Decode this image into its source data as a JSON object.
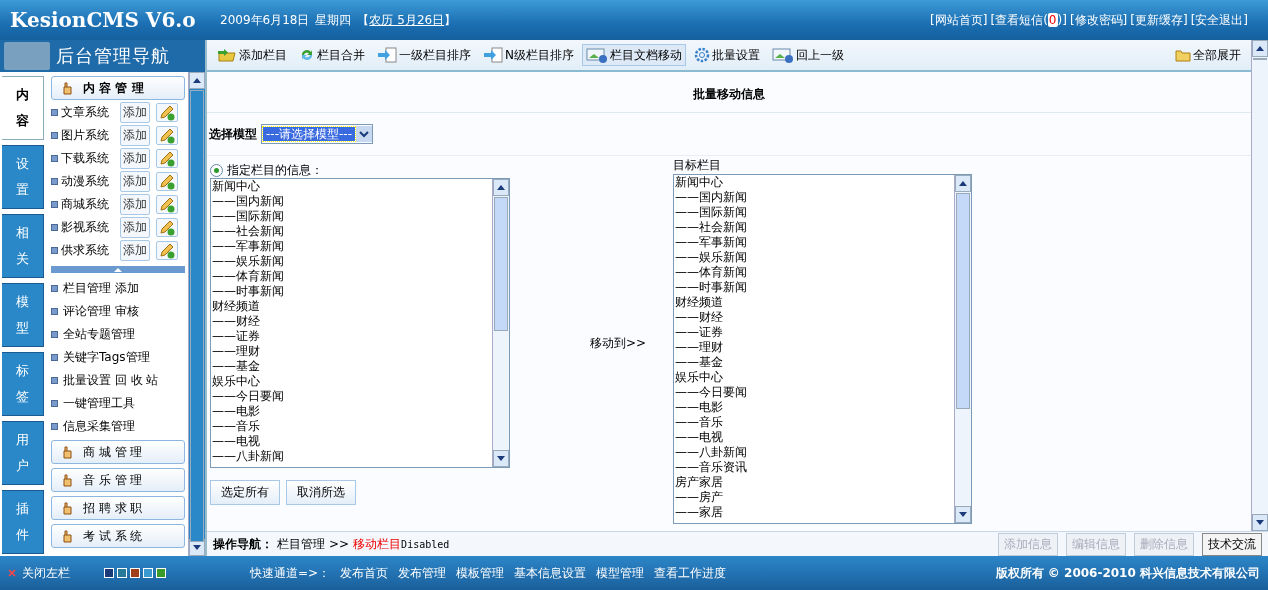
{
  "header": {
    "logo": "KesionCMS V6.o",
    "date": "2009年6月18日",
    "weekday": "星期四",
    "lunar_open": "【",
    "lunar": "农历 5月26日",
    "lunar_close": "】",
    "links": [
      {
        "text": "[网站首页]"
      },
      {
        "text": "[查看短信(",
        "count": "0",
        "after": ")]"
      },
      {
        "text": "[修改密码]"
      },
      {
        "text": "[更新缓存]"
      },
      {
        "text": "[安全退出]"
      }
    ]
  },
  "sidebar": {
    "banner_title": "后台管理导航",
    "tabs": [
      {
        "label": "内容",
        "selected": true
      },
      {
        "label": "设置",
        "selected": false
      },
      {
        "label": "相关",
        "selected": false
      },
      {
        "label": "模型",
        "selected": false
      },
      {
        "label": "标签",
        "selected": false
      },
      {
        "label": "用户",
        "selected": false
      },
      {
        "label": "插件",
        "selected": false
      }
    ],
    "content_group": {
      "title": "内 容 管 理",
      "systems": [
        {
          "name": "文章系统",
          "add": "添加"
        },
        {
          "name": "图片系统",
          "add": "添加"
        },
        {
          "name": "下载系统",
          "add": "添加"
        },
        {
          "name": "动漫系统",
          "add": "添加"
        },
        {
          "name": "商城系统",
          "add": "添加"
        },
        {
          "name": "影视系统",
          "add": "添加"
        },
        {
          "name": "供求系统",
          "add": "添加"
        }
      ],
      "links": [
        "栏目管理 添加",
        "评论管理 审核",
        "全站专题管理",
        "关键字Tags管理",
        "批量设置 回 收 站",
        "一键管理工具",
        "信息采集管理"
      ]
    },
    "other_groups": [
      "商 城 管 理",
      "音 乐 管 理",
      "招 聘 求 职",
      "考 试 系 统"
    ]
  },
  "toolbar": {
    "items": [
      {
        "label": "添加栏目",
        "kind": "add",
        "selected": false
      },
      {
        "label": "栏目合并",
        "kind": "merge",
        "selected": false
      },
      {
        "label": "一级栏目排序",
        "kind": "sort",
        "selected": false
      },
      {
        "label": "N级栏目排序",
        "kind": "sort",
        "selected": false
      },
      {
        "label": "栏目文档移动",
        "kind": "move",
        "selected": true
      },
      {
        "label": "批量设置",
        "kind": "gear",
        "selected": false
      },
      {
        "label": "回上一级",
        "kind": "move",
        "selected": false
      }
    ],
    "expand_all": "全部展开"
  },
  "panel": {
    "title": "批量移动信息",
    "model_label": "选择模型",
    "model_select": "---请选择模型---",
    "radio": {
      "label": "指定栏目的信息：",
      "checked": true
    },
    "source_list": [
      "新闻中心",
      "——国内新闻",
      "——国际新闻",
      "——社会新闻",
      "——军事新闻",
      "——娱乐新闻",
      "——体育新闻",
      "——时事新闻",
      "财经频道",
      "——财经",
      "——证券",
      "——理财",
      "——基金",
      "娱乐中心",
      "——今日要闻",
      "——电影",
      "——音乐",
      "——电视",
      "——八卦新闻"
    ],
    "select_buttons": [
      "选定所有",
      "取消所选"
    ],
    "move_label": "移动到>>",
    "target_label": "目标栏目",
    "target_list": [
      "新闻中心",
      "——国内新闻",
      "——国际新闻",
      "——社会新闻",
      "——军事新闻",
      "——娱乐新闻",
      "——体育新闻",
      "——时事新闻",
      "财经频道",
      "——财经",
      "——证券",
      "——理财",
      "——基金",
      "娱乐中心",
      "——今日要闻",
      "——电影",
      "——音乐",
      "——电视",
      "——八卦新闻",
      "——音乐资讯",
      "房产家居",
      "——房产",
      "——家居"
    ]
  },
  "breadcrumb": {
    "label": "操作导航：",
    "path": "栏目管理",
    "separator": ">>",
    "current": "移动栏目",
    "status": "Disabled"
  },
  "actions": [
    {
      "label": "添加信息",
      "disabled": true
    },
    {
      "label": "编辑信息",
      "disabled": true
    },
    {
      "label": "删除信息",
      "disabled": true
    },
    {
      "label": "技术交流",
      "disabled": false
    }
  ],
  "footer": {
    "close_left": "关闭左栏",
    "swatches": [
      {
        "color": "#1a3a7a"
      },
      {
        "color": "#2a7a9a"
      },
      {
        "color": "#a0401a"
      },
      {
        "color": "#3a9ad0"
      },
      {
        "color": "#3a9a2a"
      }
    ],
    "quick_label": "快速通道=>：",
    "quick_links": [
      "发布首页",
      "发布管理",
      "模板管理",
      "基本信息设置",
      "模型管理",
      "查看工作进度"
    ],
    "copyright": "版权所有 © 2006-2010 科兴信息技术有限公司"
  }
}
